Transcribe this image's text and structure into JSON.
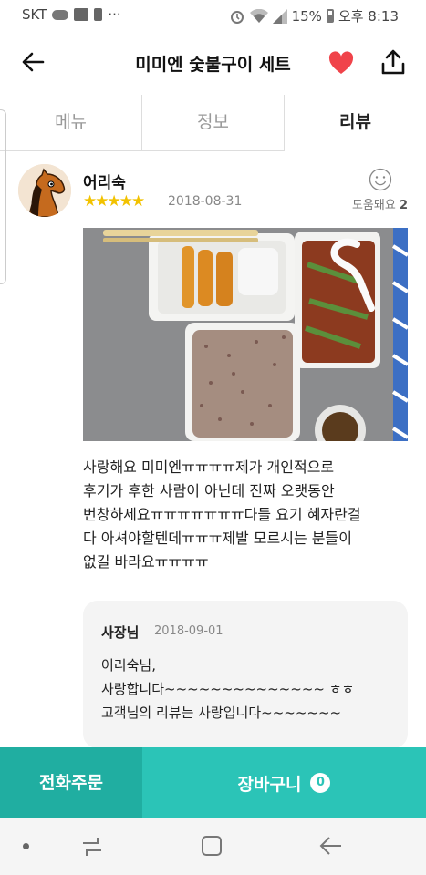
{
  "status": {
    "carrier": "SKT",
    "more": "···",
    "battery": "15%",
    "time": "오후 8:13",
    "icons": [
      "cloud-icon",
      "image-icon",
      "battery-alert-icon",
      "alarm-icon",
      "wifi-icon",
      "signal-icon",
      "battery-icon"
    ]
  },
  "header": {
    "title": "미미엔 숯불구이 세트",
    "back_icon": "back-arrow-icon",
    "favorite_icon": "heart-icon",
    "favorite_color": "#f0434a",
    "share_icon": "share-icon"
  },
  "tabs": [
    {
      "label": "메뉴",
      "active": false
    },
    {
      "label": "정보",
      "active": false
    },
    {
      "label": "리뷰",
      "active": true
    }
  ],
  "review": {
    "author": "어리숙",
    "rating": 5,
    "stars": "★★★★★",
    "date": "2018-08-31",
    "helpful_label": "도움돼요",
    "helpful_count": "2",
    "body": "사랑해요 미미엔ㅠㅠㅠㅠ제가 개인적으로\n후기가 후한 사람이 아닌데 진짜 오랫동안\n번창하세요ㅠㅠㅠㅠㅠㅠㅠ다들 요기 혜자란걸\n다 아셔야할텐데ㅠㅠㅠ제발 모르시는 분들이\n없길 바라요ㅠㅠㅠㅠ",
    "reply": {
      "author": "사장님",
      "date": "2018-09-01",
      "text": "어리숙님,\n사랑합니다~~~~~~~~~~~~~~ ㅎㅎ\n고객님의 리뷰는 사랑입니다~~~~~~~"
    }
  },
  "bottom": {
    "phone_order": "전화주문",
    "cart": "장바구니",
    "cart_count": "0"
  },
  "colors": {
    "accent": "#2bc4b7",
    "accent_dark": "#20aea1",
    "star": "#f2c200"
  }
}
